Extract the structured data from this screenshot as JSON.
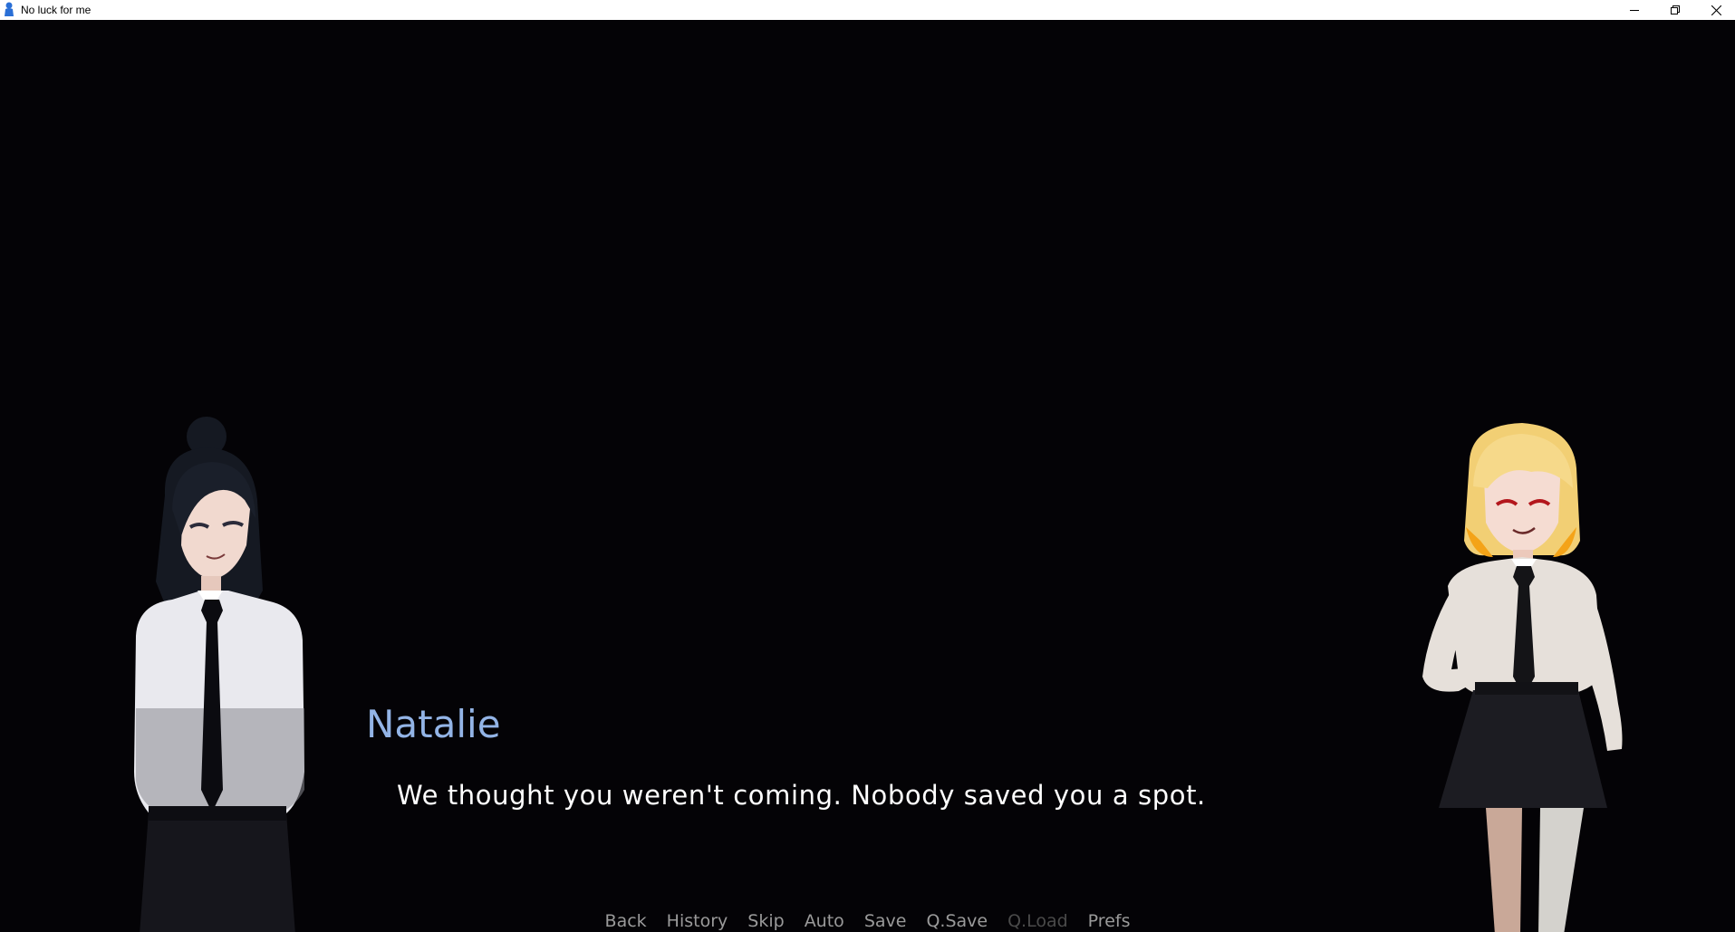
{
  "window": {
    "title": "No luck for me",
    "controls": {
      "minimize": "minimize-icon",
      "maximize": "restore-icon",
      "close": "close-icon"
    }
  },
  "dialogue": {
    "speaker": "Natalie",
    "speaker_color": "#93b4e6",
    "text": "We thought you weren't coming. Nobody saved you a spot."
  },
  "characters": [
    {
      "id": "left",
      "hair": "black",
      "outfit": "white shirt, black tie, black skirt"
    },
    {
      "id": "right",
      "hair": "blonde",
      "eyes": "red",
      "outfit": "white shirt, black tie, black skirt"
    }
  ],
  "quick_menu": {
    "back": "Back",
    "history": "History",
    "skip": "Skip",
    "auto": "Auto",
    "save": "Save",
    "qsave": "Q.Save",
    "qload": "Q.Load",
    "prefs": "Prefs"
  }
}
